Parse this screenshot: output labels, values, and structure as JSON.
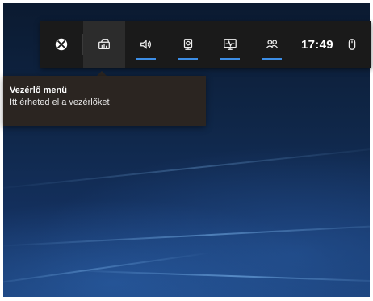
{
  "toolbar": {
    "buttons": [
      {
        "icon": "xbox-icon",
        "underline": false,
        "active": false
      },
      {
        "icon": "widget-menu-icon",
        "underline": false,
        "active": true
      },
      {
        "icon": "audio-icon",
        "underline": true,
        "active": false
      },
      {
        "icon": "capture-icon",
        "underline": true,
        "active": false
      },
      {
        "icon": "performance-icon",
        "underline": true,
        "active": false
      },
      {
        "icon": "social-icon",
        "underline": true,
        "active": false
      }
    ],
    "clock": "17:49",
    "mouse_icon": "mouse-icon",
    "accent_color": "#3d8ee6"
  },
  "tooltip": {
    "title": "Vezérlő menü",
    "description": "Itt érheted el a vezérlőket"
  }
}
